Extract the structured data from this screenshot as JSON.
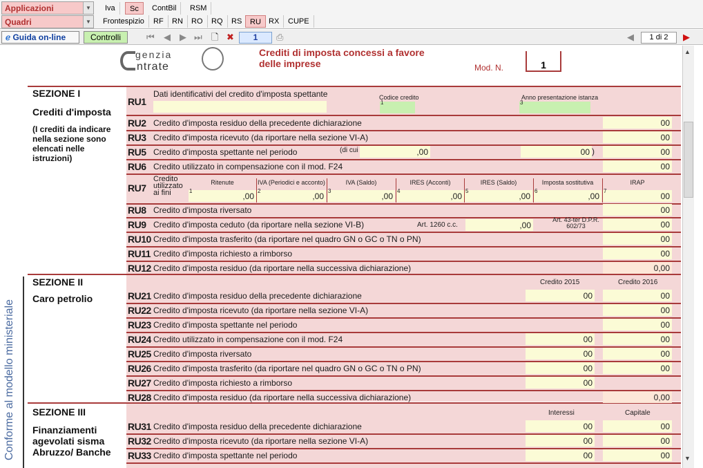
{
  "topbar": {
    "applicazioni": "Applicazioni",
    "quadri": "Quadri",
    "tabs1": [
      "Iva",
      "Sc",
      "ContBil",
      "RSM"
    ],
    "tabs2": [
      "Frontespizio",
      "RF",
      "RN",
      "RO",
      "RQ",
      "RS",
      "RU",
      "RX",
      "CUPE"
    ]
  },
  "toolbar": {
    "guida": "Guida on-line",
    "controlli": "Controlli",
    "module_num": "1",
    "pages": "1 di 2"
  },
  "header": {
    "agency_top": "genzia",
    "agency_bottom": "ntrate",
    "title_line1": "Crediti di imposta concessi a favore",
    "title_line2": "delle imprese",
    "mod_label": "Mod. N.",
    "mod_value": "1"
  },
  "side_label": "Conforme al modello ministeriale",
  "sections": {
    "s1_title": "SEZIONE I",
    "s1_sub": "Crediti d'imposta",
    "s1_note": "(I crediti da indicare nella sezione sono elencati nelle istruzioni)",
    "s2_title": "SEZIONE II",
    "s2_sub": "Caro petrolio",
    "s3_title": "SEZIONE III",
    "s3_sub": "Finanziamenti agevolati sisma Abruzzo/ Banche"
  },
  "ru1": {
    "code": "RU1",
    "desc": "Dati identificativi del credito d'imposta spettante",
    "codice_credito": "Codice credito",
    "anno": "Anno presentazione istanza"
  },
  "rows1": [
    {
      "code": "RU2",
      "desc": "Credito d'imposta residuo della precedente dichiarazione",
      "value": "00"
    },
    {
      "code": "RU3",
      "desc": "Credito d'imposta ricevuto (da riportare nella sezione VI-A)",
      "value": "00"
    },
    {
      "code": "RU5",
      "desc": "Credito d'imposta spettante nel periodo",
      "value": "00"
    },
    {
      "code": "RU6",
      "desc": "Credito utilizzato in compensazione con il mod. F24",
      "value": "00"
    }
  ],
  "ru5_extra": {
    "dicui": "(di cui",
    "v1": ",00",
    "v2": "00",
    "close": ")"
  },
  "ru7": {
    "code": "RU7",
    "label": "Credito utilizzato ai fini",
    "cols": [
      "Ritenute",
      "IVA (Periodici e acconto)",
      "IVA (Saldo)",
      "IRES (Acconti)",
      "IRES (Saldo)",
      "Imposta sostitutiva",
      "IRAP"
    ],
    "vals": [
      ",00",
      ",00",
      ",00",
      ",00",
      ",00",
      ",00",
      "00"
    ]
  },
  "rows1b": [
    {
      "code": "RU8",
      "desc": "Credito d'imposta riversato",
      "value": "00"
    },
    {
      "code": "RU9",
      "desc": "Credito d'imposta ceduto (da riportare nella sezione VI-B)",
      "value": "00"
    },
    {
      "code": "RU10",
      "desc": "Credito d'imposta trasferito (da riportare nel quadro GN o GC o TN o PN)",
      "value": "00"
    },
    {
      "code": "RU11",
      "desc": "Credito d'imposta richiesto a rimborso",
      "value": "00"
    },
    {
      "code": "RU12",
      "desc": "Credito d'imposta residuo (da riportare nella successiva dichiarazione)",
      "value": "0,00"
    }
  ],
  "ru9_extra": {
    "art": "Art. 1260 c.c.",
    "v1": ",00",
    "art2": "Art. 43-ter D.P.R. 602/73"
  },
  "sec2": {
    "col1": "Credito 2015",
    "col2": "Credito 2016",
    "rows": [
      {
        "code": "RU21",
        "desc": "Credito d'imposta residuo della precedente dichiarazione",
        "v1": "00",
        "v2": "00"
      },
      {
        "code": "RU22",
        "desc": "Credito d'imposta ricevuto (da riportare nella sezione VI-A)",
        "v1": "",
        "v2": "00"
      },
      {
        "code": "RU23",
        "desc": "Credito d'imposta spettante nel periodo",
        "v1": "",
        "v2": "00"
      },
      {
        "code": "RU24",
        "desc": "Credito utilizzato in compensazione con il mod. F24",
        "v1": "00",
        "v2": "00"
      },
      {
        "code": "RU25",
        "desc": "Credito d'imposta riversato",
        "v1": "00",
        "v2": "00"
      },
      {
        "code": "RU26",
        "desc": "Credito d'imposta trasferito (da riportare nel quadro GN o GC o TN o PN)",
        "v1": "00",
        "v2": "00"
      },
      {
        "code": "RU27",
        "desc": "Credito d'imposta richiesto a rimborso",
        "v1": "00",
        "v2": ""
      },
      {
        "code": "RU28",
        "desc": "Credito d'imposta residuo (da riportare nella successiva dichiarazione)",
        "v1": "",
        "v2": "0,00"
      }
    ]
  },
  "sec3": {
    "col1": "Interessi",
    "col2": "Capitale",
    "rows": [
      {
        "code": "RU31",
        "desc": "Credito d'imposta residuo della precedente dichiarazione",
        "v1": "00",
        "v2": "00"
      },
      {
        "code": "RU32",
        "desc": "Credito d'imposta ricevuto (da riportare nella sezione VI-A)",
        "v1": "00",
        "v2": "00"
      },
      {
        "code": "RU33",
        "desc": "Credito d'imposta spettante nel periodo",
        "v1": "00",
        "v2": "00"
      }
    ]
  }
}
